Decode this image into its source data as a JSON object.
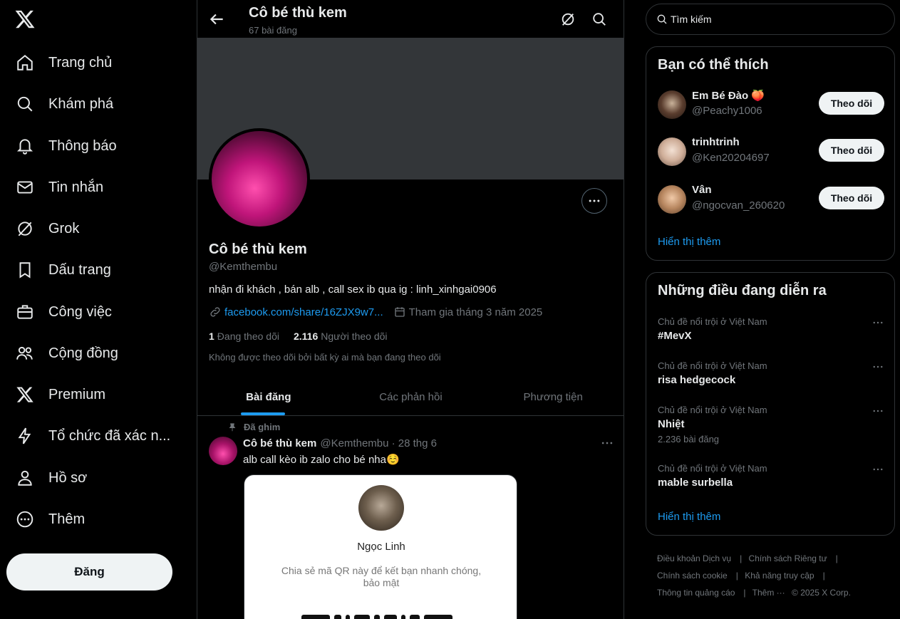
{
  "nav": {
    "items": [
      {
        "label": "Trang chủ",
        "icon": "home-icon"
      },
      {
        "label": "Khám phá",
        "icon": "search-icon"
      },
      {
        "label": "Thông báo",
        "icon": "bell-icon"
      },
      {
        "label": "Tin nhắn",
        "icon": "mail-icon"
      },
      {
        "label": "Grok",
        "icon": "grok-icon"
      },
      {
        "label": "Dấu trang",
        "icon": "bookmark-icon"
      },
      {
        "label": "Công việc",
        "icon": "briefcase-icon"
      },
      {
        "label": "Cộng đồng",
        "icon": "people-icon"
      },
      {
        "label": "Premium",
        "icon": "x-logo-icon"
      },
      {
        "label": "Tổ chức đã xác n...",
        "icon": "lightning-icon"
      },
      {
        "label": "Hồ sơ",
        "icon": "person-icon"
      },
      {
        "label": "Thêm",
        "icon": "more-circle-icon"
      }
    ],
    "post_label": "Đăng"
  },
  "header": {
    "title": "Cô bé thù kem",
    "post_count": "67 bài đăng"
  },
  "profile": {
    "name": "Cô bé thù kem",
    "handle": "@Kemthembu",
    "bio": "nhận đi khách , bán alb , call sex ib qua ig : linh_xinhgai0906",
    "link": "facebook.com/share/16ZJX9w7...",
    "joined": "Tham gia tháng 3 năm 2025",
    "following_count": "1",
    "following_label": "Đang theo dõi",
    "followers_count": "2.116",
    "followers_label": "Người theo dõi",
    "not_followed": "Không được theo dõi bởi bất kỳ ai mà bạn đang theo dõi"
  },
  "tabs": [
    "Bài đăng",
    "Các phản hồi",
    "Phương tiện"
  ],
  "tweet": {
    "pinned_label": "Đã ghim",
    "name": "Cô bé thù kem",
    "handle_time": "@Kemthembu · 28 thg 6",
    "text": "alb call kèo ib zalo cho bé nha☺️",
    "card": {
      "name": "Ngọc Linh",
      "desc": "Chia sẻ mã QR này để kết bạn nhanh chóng, bảo mật"
    }
  },
  "search": {
    "placeholder": "Tìm kiếm"
  },
  "who_to_follow": {
    "title": "Bạn có thể thích",
    "users": [
      {
        "name": "Em Bé Đào 🍑",
        "handle": "@Peachy1006",
        "button": "Theo dõi"
      },
      {
        "name": "trinhtrinh",
        "handle": "@Ken20204697",
        "button": "Theo dõi"
      },
      {
        "name": "Vân",
        "handle": "@ngocvan_260620",
        "button": "Theo dõi"
      }
    ],
    "show_more": "Hiển thị thêm"
  },
  "trends": {
    "title": "Những điều đang diễn ra",
    "items": [
      {
        "context": "Chủ đề nổi trội ở Việt Nam",
        "topic": "#MevX",
        "count": ""
      },
      {
        "context": "Chủ đề nổi trội ở Việt Nam",
        "topic": "risa hedgecock",
        "count": ""
      },
      {
        "context": "Chủ đề nổi trội ở Việt Nam",
        "topic": "Nhiệt",
        "count": "2.236 bài đăng"
      },
      {
        "context": "Chủ đề nổi trội ở Việt Nam",
        "topic": "mable surbella",
        "count": ""
      }
    ],
    "show_more": "Hiển thị thêm"
  },
  "footer": {
    "terms": "Điều khoản Dịch vụ",
    "privacy": "Chính sách Riêng tư",
    "cookie": "Chính sách cookie",
    "access": "Khả năng truy cập",
    "ads": "Thông tin quảng cáo",
    "more": "Thêm ···",
    "copyright": "© 2025 X Corp."
  },
  "colors": {
    "accent": "#1d9bf0",
    "background": "#000000",
    "border": "#2f3336"
  }
}
